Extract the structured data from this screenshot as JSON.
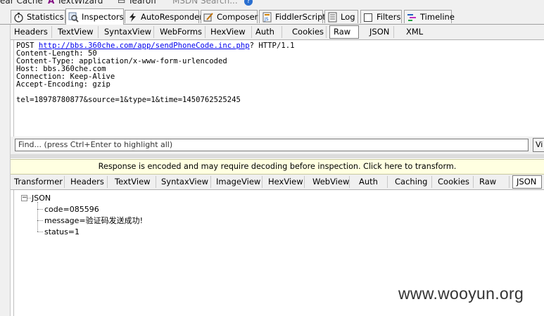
{
  "top_toolbar": {
    "items": [
      "ear Cache",
      "TextWizard",
      "Tearoff",
      "MSDN Search..."
    ]
  },
  "main_tabs": [
    {
      "label": "Statistics",
      "icon": "stopwatch-icon"
    },
    {
      "label": "Inspectors",
      "icon": "magnifier-icon",
      "active": true
    },
    {
      "label": "AutoResponder",
      "icon": "lightning-icon"
    },
    {
      "label": "Composer",
      "icon": "pencil-icon"
    },
    {
      "label": "FiddlerScript",
      "icon": "js-file-icon"
    },
    {
      "label": "Log",
      "icon": "log-icon"
    },
    {
      "label": "Filters",
      "icon": "checkbox-icon"
    },
    {
      "label": "Timeline",
      "icon": "timeline-icon"
    }
  ],
  "request_tabs": [
    "Headers",
    "TextView",
    "SyntaxView",
    "WebForms",
    "HexView",
    "Auth",
    "Cookies",
    "Raw",
    "JSON",
    "XML"
  ],
  "request_active_tab": "Raw",
  "request": {
    "method": "POST",
    "url": "http://bbs.360che.com/app/sendPhoneCode.inc.php",
    "protocol": "? HTTP/1.1",
    "headers": [
      "Content-Length: 50",
      "Content-Type: application/x-www-form-urlencoded",
      "Host: bbs.360che.com",
      "Connection: Keep-Alive",
      "Accept-Encoding: gzip"
    ],
    "body": "tel=18978780877&source=1&type=1&time=1450762525245"
  },
  "find": {
    "placeholder": "Find... (press Ctrl+Enter to highlight all)",
    "view_button": "Vi"
  },
  "banner": "Response is encoded and may require decoding before inspection. Click here to transform.",
  "response_tabs": [
    "Transformer",
    "Headers",
    "TextView",
    "SyntaxView",
    "ImageView",
    "HexView",
    "WebView",
    "Auth",
    "Caching",
    "Cookies",
    "Raw",
    "JSON"
  ],
  "response_active_tab": "JSON",
  "json_tree": {
    "expander": "−",
    "root": "JSON",
    "children": [
      "code=085596",
      "message=验证码发送成功!",
      "status=1"
    ]
  },
  "watermark": "www.wooyun.org",
  "colors": {
    "banner_bg": "#ffffe1",
    "link": "#0000ee",
    "chrome_bg": "#f0f0f0"
  }
}
